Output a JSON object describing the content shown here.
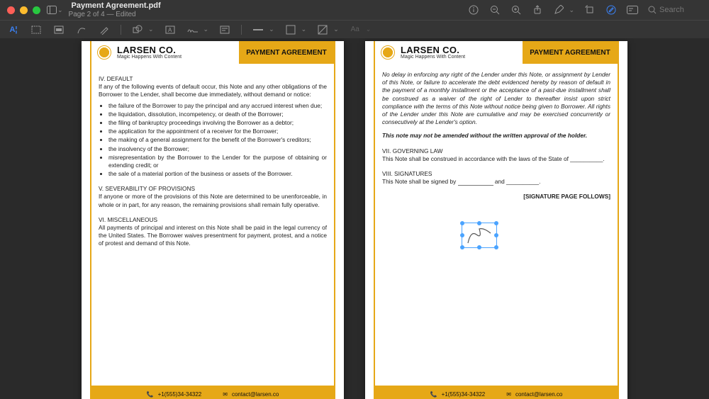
{
  "window": {
    "title": "Payment Agreement.pdf",
    "subtitle": "Page 2 of 4 — Edited"
  },
  "search": {
    "placeholder": "Search"
  },
  "brand": {
    "name": "LARSEN CO.",
    "tagline": "Magic Happens With Content",
    "flag": "PAYMENT AGREEMENT"
  },
  "footer": {
    "phone": "+1(555)34-34322",
    "email": "contact@larsen.co"
  },
  "pageL": {
    "s1_h": "IV. DEFAULT",
    "s1_p": "If any of the following events of default occur, this Note and any other obligations of the Borrower to the Lender, shall become due immediately, without demand or notice:",
    "bul": [
      "the failure of the Borrower to pay the principal and any accrued interest when due;",
      "the liquidation, dissolution, incompetency, or death of the Borrower;",
      "the filing of bankruptcy proceedings involving the Borrower as a debtor;",
      "the application for the appointment of a receiver for the Borrower;",
      "the making of a general assignment for the benefit of the Borrower's creditors;",
      "the insolvency of the Borrower;",
      "misrepresentation by the Borrower to the Lender for the purpose of obtaining or extending credit; or",
      "the sale of a material portion of the business or assets of the Borrower."
    ],
    "s2_h": "V. SEVERABILITY OF PROVISIONS",
    "s2_p": "If anyone or more of the provisions of this Note are determined to be unenforceable, in whole or in part, for any reason, the remaining provisions shall remain fully operative.",
    "s3_h": "VI. MISCELLANEOUS",
    "s3_p": "All payments of principal and interest on this Note shall be paid in the legal currency of the United States. The Borrower waives presentment for payment, protest, and a notice of protest and demand of this Note."
  },
  "pageR": {
    "p1": "No delay in enforcing any right of the Lender under this Note, or assignment by Lender of this Note, or failure to accelerate the debt evidenced hereby by reason of default in the payment of a monthly installment or the acceptance of a past-due installment shall be construed as a waiver of the right of Lender to thereafter insist upon strict compliance with the terms of this Note without notice being given to Borrower. All rights of the Lender under this Note are cumulative and may be exercised concurrently or consecutively at the Lender's option.",
    "p2": "This note may not be amended without the written approval of the holder.",
    "s1_h": "VII. GOVERNING LAW",
    "s1_p": "This Note shall be construed in accordance with the laws of the State of __________.",
    "s2_h": "VIII. SIGNATURES",
    "s2_a": "This Note shall be signed by ",
    "s2_b": " and __________.",
    "follow": "[SIGNATURE PAGE FOLLOWS]"
  }
}
